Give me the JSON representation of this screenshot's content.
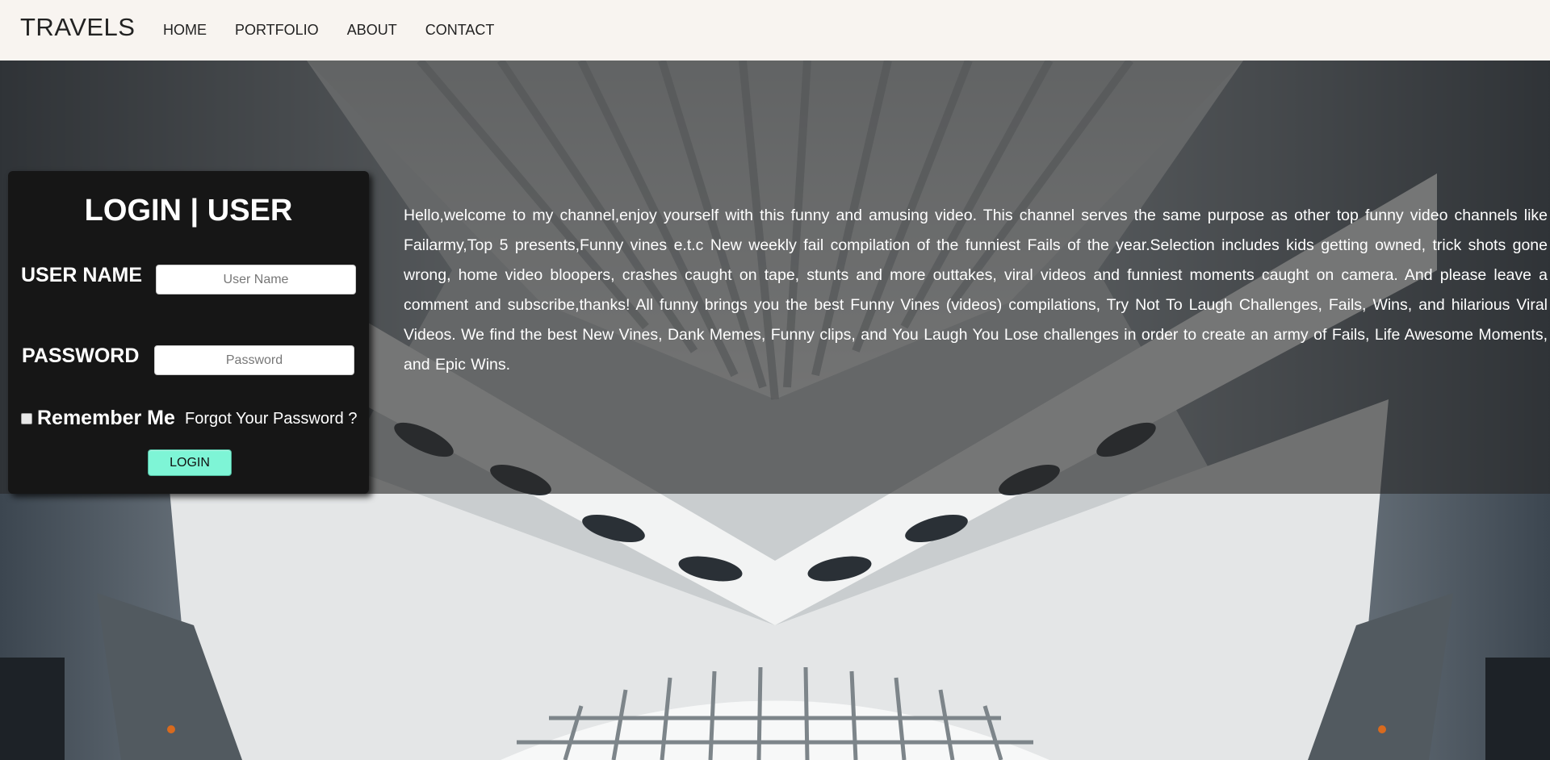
{
  "navbar": {
    "brand": "TRAVELS",
    "links": [
      "HOME",
      "PORTFOLIO",
      "ABOUT",
      "CONTACT"
    ]
  },
  "login": {
    "title": "LOGIN | USER",
    "username_label": "USER NAME",
    "username_placeholder": "User Name",
    "password_label": "PASSWORD",
    "password_placeholder": "Password",
    "remember_label": "Remember Me",
    "forgot_label": "Forgot Your Password ?",
    "button_label": "LOGIN"
  },
  "main": {
    "description": "Hello,welcome to my channel,enjoy yourself with this funny and amusing video. This channel serves the same purpose as other top funny video channels like Failarmy,Top 5 presents,Funny vines e.t.c New weekly fail compilation of the funniest Fails of the year.Selection includes kids getting owned, trick shots gone wrong, home video bloopers, crashes caught on tape, stunts and more outtakes, viral videos and funniest moments caught on camera. And please leave a comment and subscribe,thanks! All funny brings you the best Funny Vines (videos) compilations, Try Not To Laugh Challenges, Fails, Wins, and hilarious Viral Videos. We find the best New Vines, Dank Memes, Funny clips, and You Laugh You Lose challenges in order to create an army of Fails, Life Awesome Moments, and Epic Wins."
  },
  "colors": {
    "navbar_bg": "#f8f4f0",
    "panel_bg": "#161616",
    "button_accent": "#7ef5d6"
  }
}
